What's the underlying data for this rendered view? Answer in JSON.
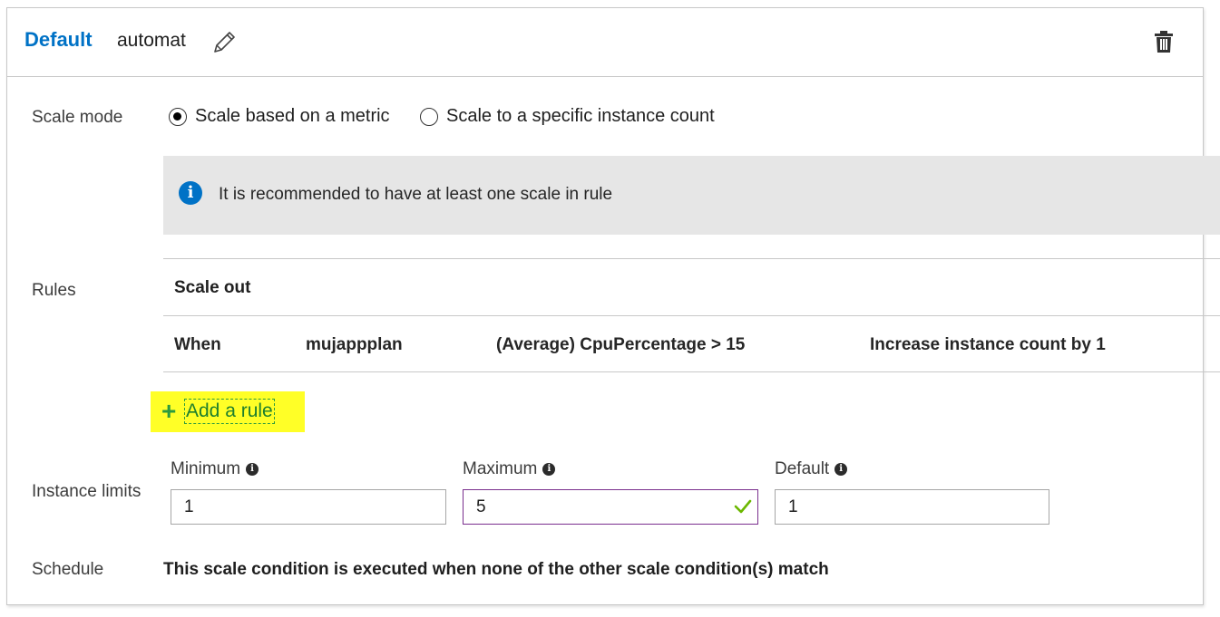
{
  "header": {
    "profile_type": "Default",
    "profile_name": "automat"
  },
  "scale_mode": {
    "label": "Scale mode",
    "options": [
      {
        "label": "Scale based on a metric",
        "selected": true
      },
      {
        "label": "Scale to a specific instance count",
        "selected": false
      }
    ]
  },
  "info_banner": {
    "text": "It is recommended to have at least one scale in rule"
  },
  "rules": {
    "label": "Rules",
    "section_title": "Scale out",
    "rows": [
      {
        "when": "When",
        "resource": "mujappplan",
        "condition": "(Average) CpuPercentage > 15",
        "action": "Increase instance count by 1"
      }
    ],
    "add_rule_label": "Add a rule"
  },
  "instance_limits": {
    "label": "Instance limits",
    "minimum": {
      "label": "Minimum",
      "value": "1"
    },
    "maximum": {
      "label": "Maximum",
      "value": "5"
    },
    "default": {
      "label": "Default",
      "value": "1"
    }
  },
  "schedule": {
    "label": "Schedule",
    "text": "This scale condition is executed when none of the other scale condition(s) match"
  },
  "colors": {
    "accent_blue": "#0072c6",
    "highlight_yellow": "#ffff27",
    "add_green": "#2b9a3f",
    "valid_check": "#6bb700",
    "active_border": "#7a2f8e"
  }
}
